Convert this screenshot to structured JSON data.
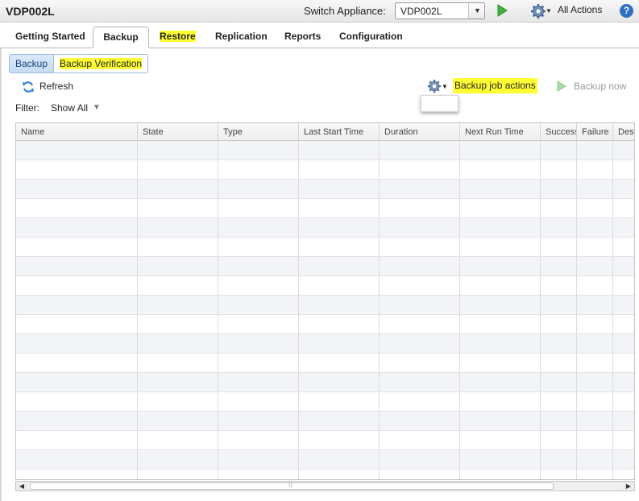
{
  "titlebar": {
    "app_title": "VDP002L",
    "switch_label": "Switch Appliance:",
    "appliance_value": "VDP002L",
    "all_actions_label": "All Actions",
    "help_glyph": "?"
  },
  "tabs": [
    {
      "label": "Getting Started"
    },
    {
      "label": "Backup",
      "active": true
    },
    {
      "label": "Restore",
      "highlighted": true
    },
    {
      "label": "Replication"
    },
    {
      "label": "Reports"
    },
    {
      "label": "Configuration"
    }
  ],
  "subtabs": [
    {
      "label": "Backup",
      "active": true
    },
    {
      "label": "Backup Verification",
      "highlighted": true
    }
  ],
  "toolbar": {
    "refresh_label": "Refresh",
    "job_actions_label": "Backup job actions",
    "backup_now_label": "Backup now"
  },
  "filter": {
    "label": "Filter:",
    "value": "Show All"
  },
  "grid": {
    "columns": [
      "Name",
      "State",
      "Type",
      "Last Start Time",
      "Duration",
      "Next Run Time",
      "Success",
      "Failure",
      "Dest"
    ],
    "rows": []
  },
  "colors": {
    "highlight": "#ffff33",
    "play_green": "#3cb33c",
    "help_blue": "#2f6fc4"
  },
  "icons": [
    "play-icon",
    "gear-icon",
    "help-icon",
    "refresh-icon",
    "chevron-down-icon"
  ]
}
